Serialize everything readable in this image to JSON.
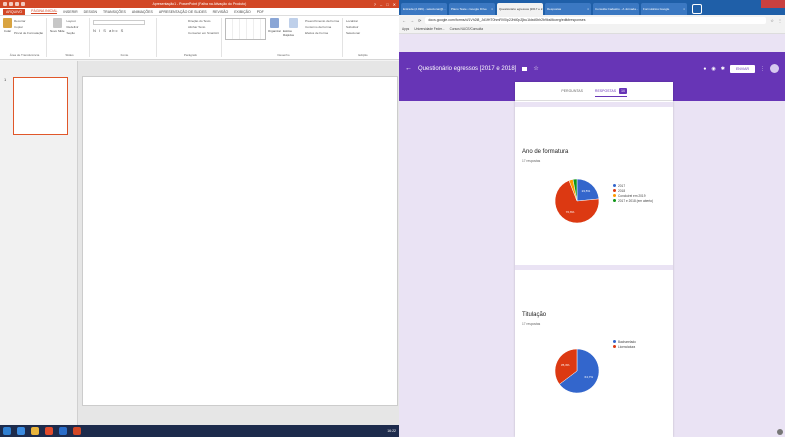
{
  "ppt": {
    "title_text": "Apresentação1 - PowerPoint (Falha na Ativação do Produto)",
    "window_controls": [
      "?",
      "–",
      "□",
      "✕"
    ],
    "tabs": [
      {
        "label": "ARQUIVO",
        "style": "file"
      },
      {
        "label": "PÁGINA INICIAL",
        "style": "active"
      },
      {
        "label": "INSERIR",
        "style": ""
      },
      {
        "label": "DESIGN",
        "style": ""
      },
      {
        "label": "TRANSIÇÕES",
        "style": ""
      },
      {
        "label": "ANIMAÇÕES",
        "style": ""
      },
      {
        "label": "APRESENTAÇÃO DE SLIDES",
        "style": ""
      },
      {
        "label": "REVISÃO",
        "style": ""
      },
      {
        "label": "EXIBIÇÃO",
        "style": ""
      },
      {
        "label": "PDF",
        "style": ""
      }
    ],
    "ribbon": {
      "clipboard": {
        "paste": "Colar",
        "cut": "Recortar",
        "copy": "Copiar",
        "painter": "Pincel de Formatação",
        "label": "Área de Transferência"
      },
      "slides": {
        "new": "Novo Slide",
        "layout": "Layout",
        "reset": "Redefinir",
        "section": "Seção",
        "label": "Slides"
      },
      "font": {
        "label": "Fonte"
      },
      "paragraph": {
        "dir": "Direção do Texto",
        "align": "Alinhar Texto",
        "smartart": "Converter em SmartArt",
        "label": "Parágrafo"
      },
      "drawing": {
        "organize": "Organizar",
        "quick": "Estilos Rápidos",
        "fill": "Preenchimento da Forma",
        "outline": "Contorno da Forma",
        "effects": "Efeitos de Forma",
        "label": "Desenho"
      },
      "editing": {
        "find": "Localizar",
        "replace": "Substituir",
        "select": "Selecionar",
        "label": "Edição"
      }
    },
    "slide_number": "1",
    "status": {
      "left": "SLIDE 1 DE 1",
      "lang": "PORTUGUÊS (BRASIL)",
      "notes": "ANOTAÇÕES",
      "comments": "COMENTÁRIOS",
      "zoom": "60%"
    }
  },
  "taskbar": {
    "clock": "16:22"
  },
  "browser": {
    "tabs": [
      {
        "label": "Entrada (2.039) - selecionar@...",
        "active": false
      },
      {
        "label": "Plano Teste • Google Drive",
        "active": false
      },
      {
        "label": "Questionário egressos [2017 e 2...",
        "active": true
      },
      {
        "label": "Respostas",
        "active": false
      },
      {
        "label": "Consulta Cadastro - A Jornada...",
        "active": false
      },
      {
        "label": "Formulários Google",
        "active": false
      }
    ],
    "url": "docs.google.com/forms/d/1Vh2l8_Jd1fHT0hmRV0ip2JhtI0pZjbu1klxd0bh2b9ksMcwrg/edit#responses",
    "bookmarks": [
      "Apps",
      "Universidade Feder...",
      "Cursos NUCE/Consulta"
    ]
  },
  "form": {
    "title": "Questionário egressos [2017 e 2018]",
    "send_label": "ENVIAR",
    "subtabs": {
      "questions": "PERGUNTAS",
      "responses": "RESPOSTAS",
      "count": "14"
    }
  },
  "chart_data": [
    {
      "type": "pie",
      "title": "Ano de formatura",
      "subtitle": "17 respostas",
      "series": [
        {
          "name": "2017",
          "value": 23.5,
          "color": "#3366cc"
        },
        {
          "name": "2018",
          "value": 70.6,
          "color": "#dc3912"
        },
        {
          "name": "Concluirei em 2019",
          "value": 3.0,
          "color": "#ff9900"
        },
        {
          "name": "2017 e 2018 (em aberto)",
          "value": 2.9,
          "color": "#109618"
        }
      ],
      "slice_labels": [
        "23,5%",
        "70,6%",
        "",
        ""
      ],
      "legend": "right"
    },
    {
      "type": "pie",
      "title": "Titulação",
      "subtitle": "17 respostas",
      "series": [
        {
          "name": "Bacharelado",
          "value": 64.7,
          "color": "#3366cc"
        },
        {
          "name": "Licenciatura",
          "value": 35.3,
          "color": "#dc3912"
        }
      ],
      "slice_labels": [
        "64,7%",
        "35,3%"
      ],
      "legend": "right"
    }
  ]
}
